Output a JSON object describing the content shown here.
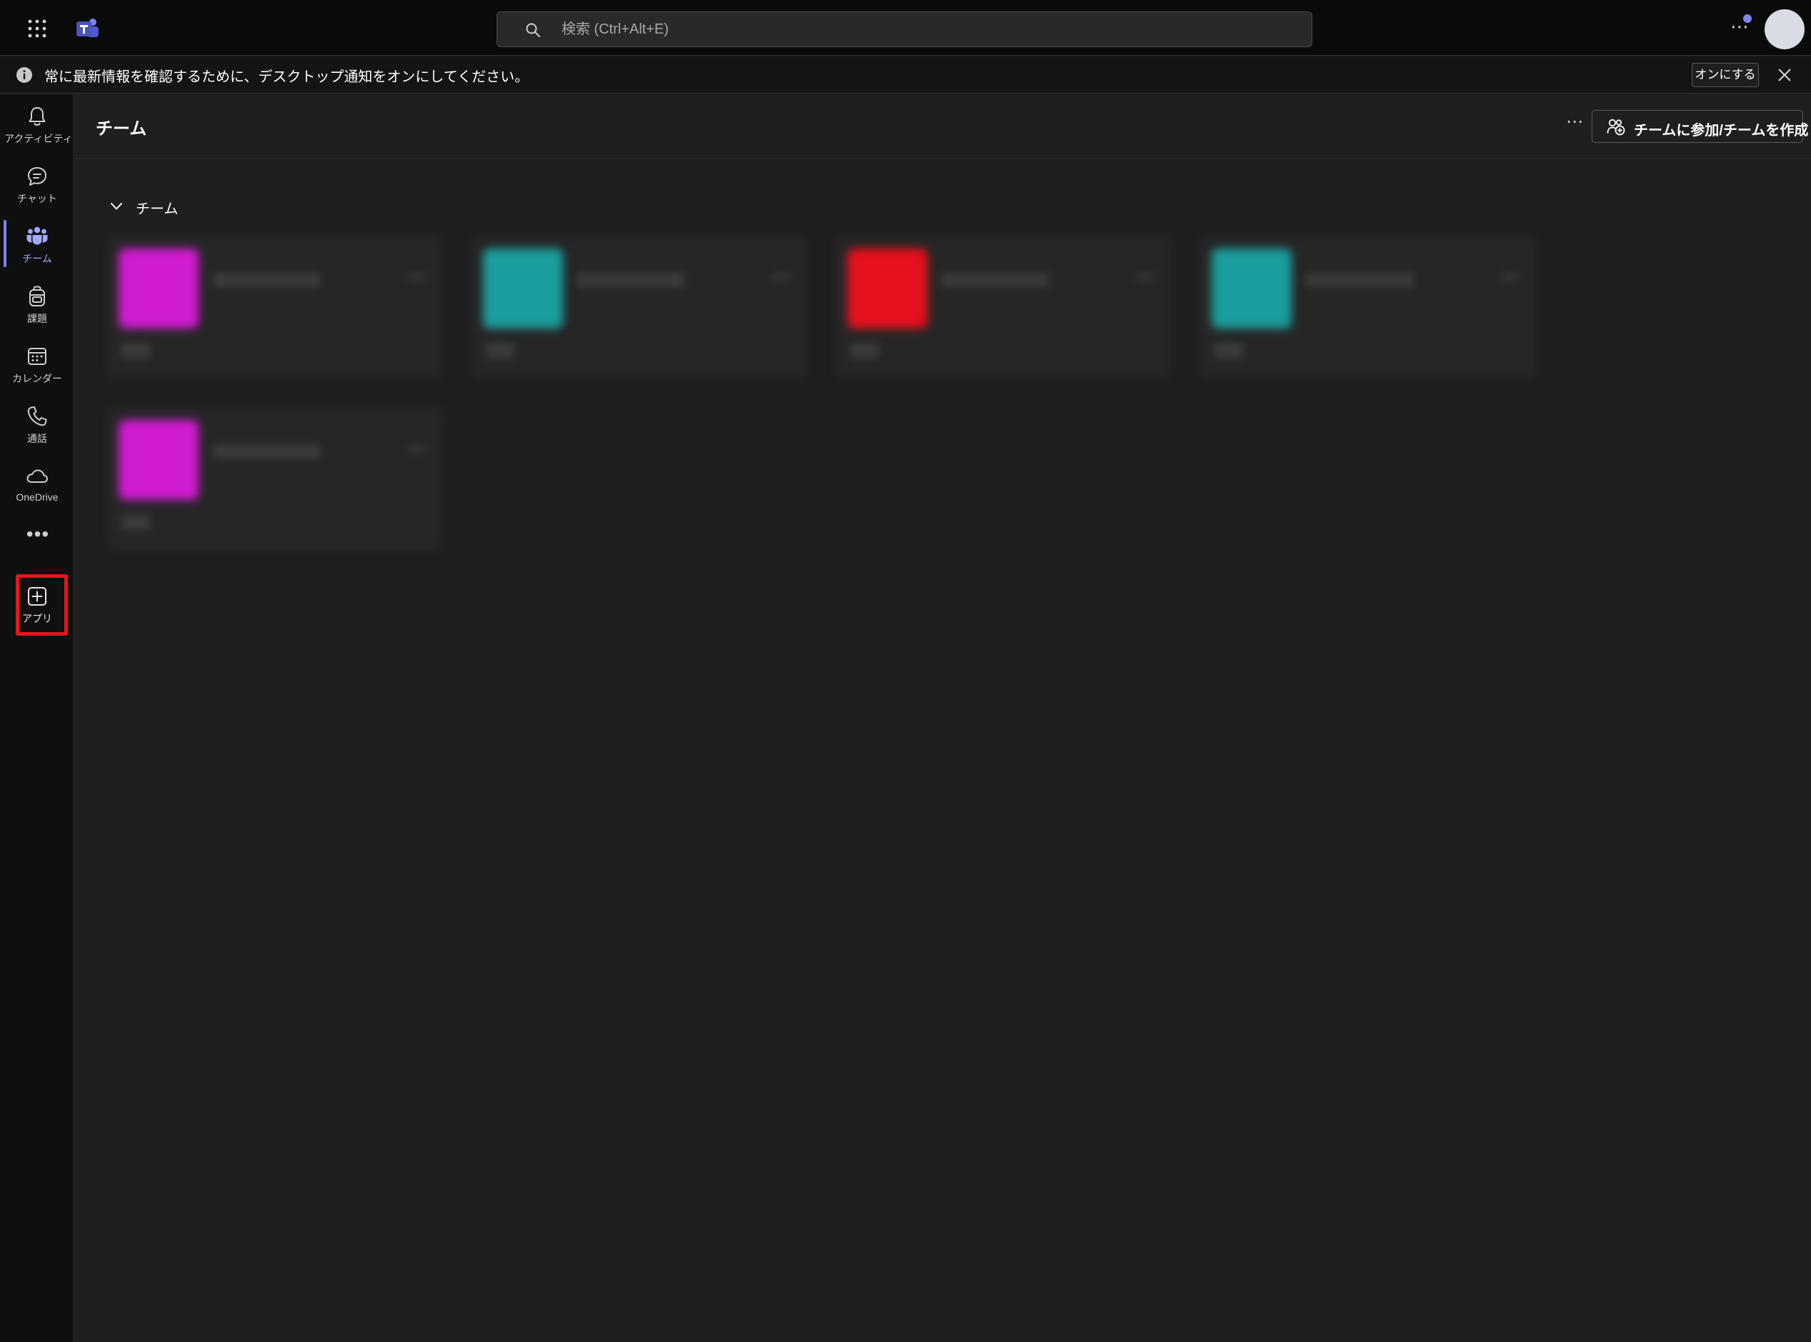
{
  "titlebar": {
    "search": {
      "placeholder": "検索 (Ctrl+Alt+E)",
      "value": ""
    },
    "icons": [
      "app-launcher-icon",
      "teams-logo-icon",
      "search-icon",
      "more-icon",
      "avatar"
    ]
  },
  "notification": {
    "message": "常に最新情報を確認するために、デスクトップ通知をオンにしてください。",
    "turn_on_label": "オンにする",
    "icons": [
      "info-icon",
      "close-icon"
    ]
  },
  "rail": {
    "items": [
      {
        "id": "activity",
        "label": "アクティビティ",
        "icon": "bell-icon",
        "active": false
      },
      {
        "id": "chat",
        "label": "チャット",
        "icon": "chat-icon",
        "active": false
      },
      {
        "id": "teams",
        "label": "チーム",
        "icon": "teams-icon",
        "active": true
      },
      {
        "id": "assignments",
        "label": "課題",
        "icon": "backpack-icon",
        "active": false
      },
      {
        "id": "calendar",
        "label": "カレンダー",
        "icon": "calendar-icon",
        "active": false
      },
      {
        "id": "calls",
        "label": "通話",
        "icon": "phone-icon",
        "active": false
      },
      {
        "id": "onedrive",
        "label": "OneDrive",
        "icon": "cloud-icon",
        "active": false
      }
    ],
    "more_label": "•••",
    "apps": {
      "label": "アプリ",
      "icon": "add-app-icon",
      "highlighted": true
    }
  },
  "main": {
    "title": "チーム",
    "more_label": "•••",
    "join_create_label": "チームに参加/チームを作成",
    "section_label": "チーム",
    "teams": [
      {
        "tile_color": "#d11bd1"
      },
      {
        "tile_color": "#1b9e9e"
      },
      {
        "tile_color": "#e8101e"
      },
      {
        "tile_color": "#1b9e9e"
      },
      {
        "tile_color": "#d11bd1"
      }
    ]
  },
  "colors": {
    "accent": "#7f85f5",
    "highlight_border": "#e8141d",
    "background": "#1f1f1f",
    "titlebar": "#0a0a0a"
  }
}
